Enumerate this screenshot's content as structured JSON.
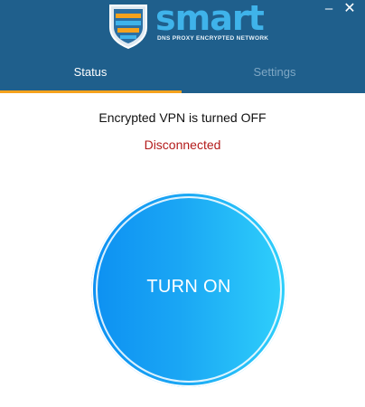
{
  "header": {
    "logo_word": "smart",
    "logo_tagline": "DNS PROXY ENCRYPTED NETWORK",
    "minimize_symbol": "–",
    "close_symbol": "✕"
  },
  "tabs": [
    {
      "label": "Status",
      "active": true
    },
    {
      "label": "Settings",
      "active": false
    }
  ],
  "status": {
    "message": "Encrypted VPN is turned OFF",
    "connection": "Disconnected"
  },
  "power_button": {
    "label": "TURN ON"
  },
  "colors": {
    "header_bg": "#1f5f8c",
    "accent_underline": "#f5a21d",
    "logo_blue": "#3fb3ea",
    "disconnected_red": "#b31b1b",
    "button_gradient_start": "#0d90f2",
    "button_gradient_end": "#2fd0fb"
  }
}
